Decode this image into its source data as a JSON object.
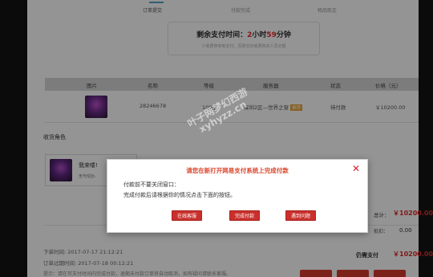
{
  "steps": [
    {
      "label": "订单提交",
      "active": true
    },
    {
      "label": "付款完成",
      "active": false
    },
    {
      "label": "物品取走",
      "active": false
    }
  ],
  "timer": {
    "prefix": "剩余支付时间：",
    "hours": "2",
    "hours_unit": "小时",
    "minutes": "59",
    "minutes_unit": "分钟",
    "subtitle": "少收费停单到支付，否则交日收费购买人员全额"
  },
  "table": {
    "headers": [
      "图片",
      "名称",
      "等级",
      "服务器",
      "状态",
      "价格（元）"
    ],
    "row": {
      "name": "28246678",
      "level": "109级",
      "server": "深圳2区—世界之窗",
      "server_tag": "推荐",
      "status": "待付款",
      "price": "￥10200.00"
    }
  },
  "receive": {
    "section_title": "收货角色",
    "role_name": "我来喽!",
    "role_desc": "无与伦比-"
  },
  "totals": {
    "total_label": "总计：",
    "total_amount": "￥10200.00",
    "discount_label": "抵扣：",
    "discount_amount": "0.00",
    "pay_label": "仍需支付",
    "pay_amount": "￥10200.00"
  },
  "footer": {
    "order_time": "下单时间: 2017-07-17 21:12:21",
    "expire_time": "订单过期时间: 2017-07-18 00:12:21",
    "note": "提示：请在可支付时间内完成付款，逾期未付款订单将自动取消，如有疑问请联系客服。"
  },
  "watermark": {
    "line1": "叶子网梦幻西游",
    "line2": "xyhyzz.cn"
  },
  "modal": {
    "title": "请您在新打开网易支付系统上完成付款",
    "close_icon": "close-icon",
    "line1": "付款前不要关闭窗口：",
    "line2": "完成付款后请根据你的情况点击下面的按钮。",
    "buttons": [
      "在线客服",
      "完成付款",
      "遇到问题"
    ]
  },
  "colors": {
    "accent_red": "#e02b2b",
    "button_red": "#c9302c",
    "modal_title": "#d8462c"
  }
}
